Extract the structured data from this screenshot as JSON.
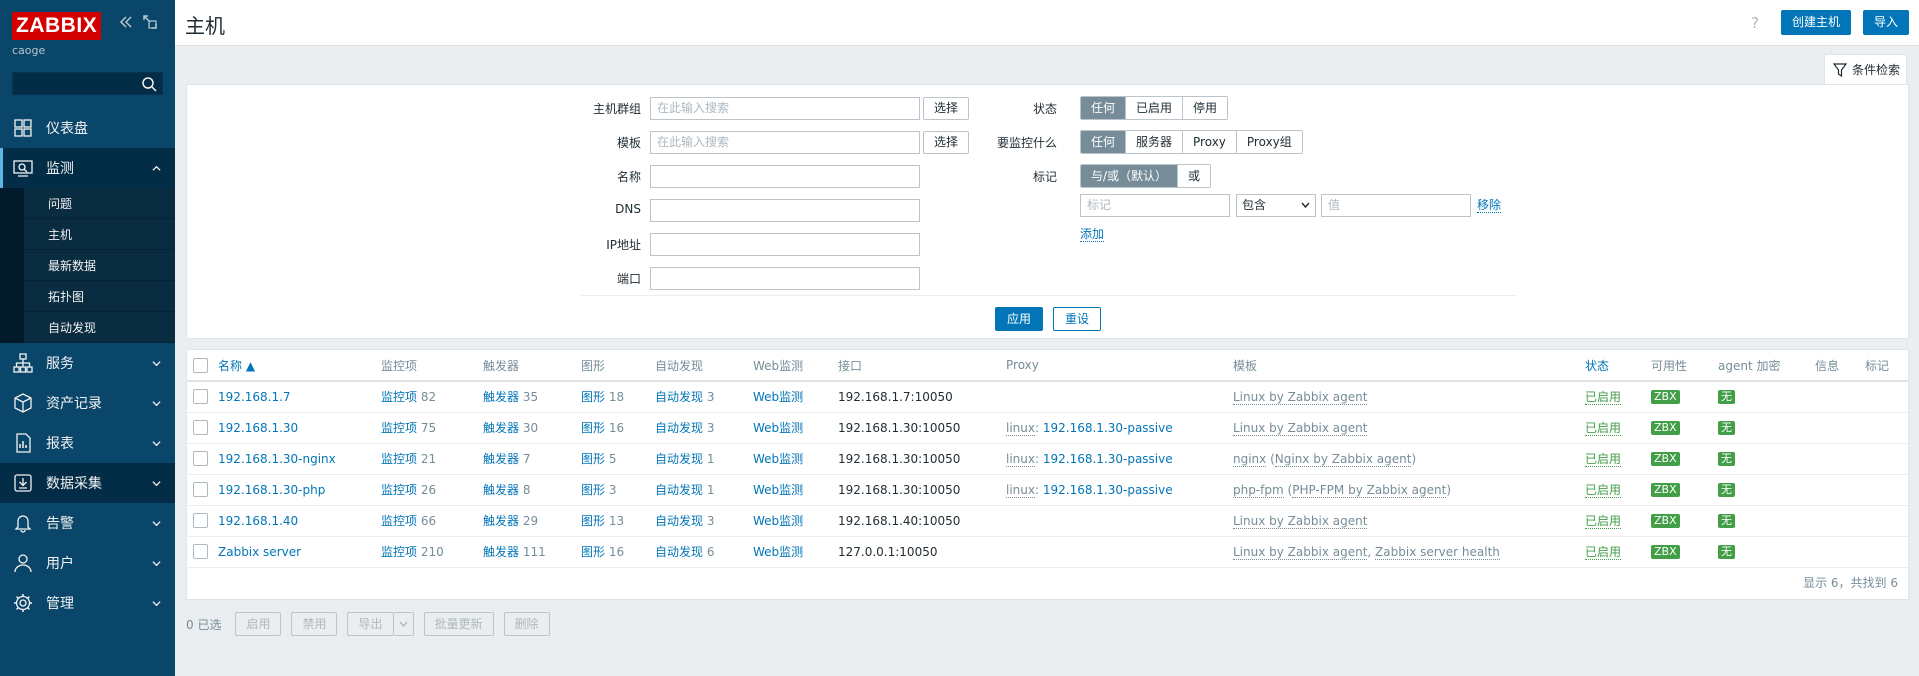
{
  "sidebar": {
    "logo": "ZABBIX",
    "user": "caoge",
    "search_placeholder": "",
    "menu": [
      {
        "label": "仪表盘",
        "icon": "dashboard-icon"
      },
      {
        "label": "监测",
        "icon": "monitoring-icon",
        "expanded": true
      },
      {
        "label": "服务",
        "icon": "services-icon"
      },
      {
        "label": "资产记录",
        "icon": "inventory-icon"
      },
      {
        "label": "报表",
        "icon": "reports-icon"
      },
      {
        "label": "数据采集",
        "icon": "data-collection-icon"
      },
      {
        "label": "告警",
        "icon": "alerts-icon"
      },
      {
        "label": "用户",
        "icon": "users-icon"
      },
      {
        "label": "管理",
        "icon": "administration-icon"
      }
    ],
    "submenu": [
      "问题",
      "主机",
      "最新数据",
      "拓扑图",
      "自动发现"
    ]
  },
  "header": {
    "title": "主机",
    "help": "?",
    "create_button": "创建主机",
    "import_button": "导入"
  },
  "filter": {
    "tab_label": "条件检索",
    "host_groups_label": "主机群组",
    "host_groups_placeholder": "在此输入搜索",
    "templates_label": "模板",
    "templates_placeholder": "在此输入搜索",
    "select_button": "选择",
    "name_label": "名称",
    "dns_label": "DNS",
    "ip_label": "IP地址",
    "port_label": "端口",
    "status_label": "状态",
    "status_options": [
      "任何",
      "已启用",
      "停用"
    ],
    "monitored_by_label": "要监控什么",
    "monitored_by_options": [
      "任何",
      "服务器",
      "Proxy",
      "Proxy组"
    ],
    "tags_label": "标记",
    "tags_options": [
      "与/或（默认）",
      "或"
    ],
    "tag_placeholder": "标记",
    "tag_operator": "包含",
    "value_placeholder": "值",
    "remove_link": "移除",
    "add_link": "添加",
    "apply_button": "应用",
    "reset_button": "重设"
  },
  "table": {
    "columns": {
      "name": "名称",
      "items": "监控项",
      "triggers": "触发器",
      "graphs": "图形",
      "discovery": "自动发现",
      "web": "Web监测",
      "interface": "接口",
      "proxy": "Proxy",
      "templates": "模板",
      "status": "状态",
      "availability": "可用性",
      "encryption": "agent 加密",
      "info": "信息",
      "tags": "标记"
    },
    "rows": [
      {
        "name": "192.168.1.7",
        "items_label": "监控项",
        "items": "82",
        "triggers_label": "触发器",
        "triggers": "35",
        "graphs_label": "图形",
        "graphs": "18",
        "discovery_label": "自动发现",
        "discovery": "3",
        "web": "Web监测",
        "interface": "192.168.1.7:10050",
        "proxy_group": "",
        "proxy_sep": "",
        "proxy": "",
        "template1": "Linux by Zabbix agent",
        "template1_paren": "",
        "template2": "",
        "status": "已启用",
        "availability": "ZBX",
        "encryption": "无"
      },
      {
        "name": "192.168.1.30",
        "items_label": "监控项",
        "items": "75",
        "triggers_label": "触发器",
        "triggers": "30",
        "graphs_label": "图形",
        "graphs": "16",
        "discovery_label": "自动发现",
        "discovery": "3",
        "web": "Web监测",
        "interface": "192.168.1.30:10050",
        "proxy_group": "linux",
        "proxy_sep": ": ",
        "proxy": "192.168.1.30-passive",
        "template1": "Linux by Zabbix agent",
        "template1_paren": "",
        "template2": "",
        "status": "已启用",
        "availability": "ZBX",
        "encryption": "无"
      },
      {
        "name": "192.168.1.30-nginx",
        "items_label": "监控项",
        "items": "21",
        "triggers_label": "触发器",
        "triggers": "7",
        "graphs_label": "图形",
        "graphs": "5",
        "discovery_label": "自动发现",
        "discovery": "1",
        "web": "Web监测",
        "interface": "192.168.1.30:10050",
        "proxy_group": "linux",
        "proxy_sep": ": ",
        "proxy": "192.168.1.30-passive",
        "template1": "nginx",
        "template1_paren": "Nginx by Zabbix agent",
        "template2": "",
        "status": "已启用",
        "availability": "ZBX",
        "encryption": "无"
      },
      {
        "name": "192.168.1.30-php",
        "items_label": "监控项",
        "items": "26",
        "triggers_label": "触发器",
        "triggers": "8",
        "graphs_label": "图形",
        "graphs": "3",
        "discovery_label": "自动发现",
        "discovery": "1",
        "web": "Web监测",
        "interface": "192.168.1.30:10050",
        "proxy_group": "linux",
        "proxy_sep": ": ",
        "proxy": "192.168.1.30-passive",
        "template1": "php-fpm",
        "template1_paren": "PHP-FPM by Zabbix agent",
        "template2": "",
        "status": "已启用",
        "availability": "ZBX",
        "encryption": "无"
      },
      {
        "name": "192.168.1.40",
        "items_label": "监控项",
        "items": "66",
        "triggers_label": "触发器",
        "triggers": "29",
        "graphs_label": "图形",
        "graphs": "13",
        "discovery_label": "自动发现",
        "discovery": "3",
        "web": "Web监测",
        "interface": "192.168.1.40:10050",
        "proxy_group": "",
        "proxy_sep": "",
        "proxy": "",
        "template1": "Linux by Zabbix agent",
        "template1_paren": "",
        "template2": "",
        "status": "已启用",
        "availability": "ZBX",
        "encryption": "无"
      },
      {
        "name": "Zabbix server",
        "items_label": "监控项",
        "items": "210",
        "triggers_label": "触发器",
        "triggers": "111",
        "graphs_label": "图形",
        "graphs": "16",
        "discovery_label": "自动发现",
        "discovery": "6",
        "web": "Web监测",
        "interface": "127.0.0.1:10050",
        "proxy_group": "",
        "proxy_sep": "",
        "proxy": "",
        "template1": "Linux by Zabbix agent",
        "template1_paren": "",
        "template2": "Zabbix server health",
        "status": "已启用",
        "availability": "ZBX",
        "encryption": "无"
      }
    ],
    "footer": "显示 6，共找到 6"
  },
  "actions": {
    "selected": "0 已选",
    "enable": "启用",
    "disable": "禁用",
    "export": "导出",
    "mass_update": "批量更新",
    "delete": "删除"
  },
  "colors": {
    "sidebar_bg": "#0a466a",
    "primary": "#0275b8",
    "enabled_green": "#429e47",
    "logo_red": "#d40000"
  }
}
